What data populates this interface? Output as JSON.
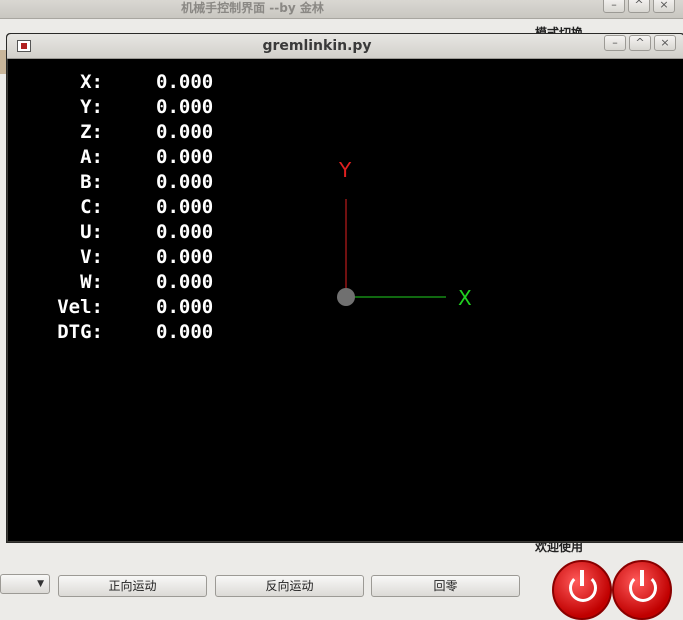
{
  "background_window": {
    "title": "机械手控制界面 --by 金林",
    "mode_label": "模式切换",
    "welcome_label": "欢迎使用",
    "bottom_buttons": [
      "正向运动",
      "反向运动",
      "回零"
    ]
  },
  "window": {
    "title": "gremlinkin.py",
    "controls": {
      "minimize": "–",
      "maximize": "^",
      "close": "×"
    }
  },
  "dro": [
    {
      "label": "X:",
      "value": "0.000"
    },
    {
      "label": "Y:",
      "value": "0.000"
    },
    {
      "label": "Z:",
      "value": "0.000"
    },
    {
      "label": "A:",
      "value": "0.000"
    },
    {
      "label": "B:",
      "value": "0.000"
    },
    {
      "label": "C:",
      "value": "0.000"
    },
    {
      "label": "U:",
      "value": "0.000"
    },
    {
      "label": "V:",
      "value": "0.000"
    },
    {
      "label": "W:",
      "value": "0.000"
    },
    {
      "label": "Vel:",
      "value": "0.000"
    },
    {
      "label": "DTG:",
      "value": "0.000"
    }
  ],
  "axes": {
    "y_label": "Y",
    "x_label": "X",
    "y_color": "#e02020",
    "x_color": "#20d020",
    "origin_color": "#707070"
  }
}
